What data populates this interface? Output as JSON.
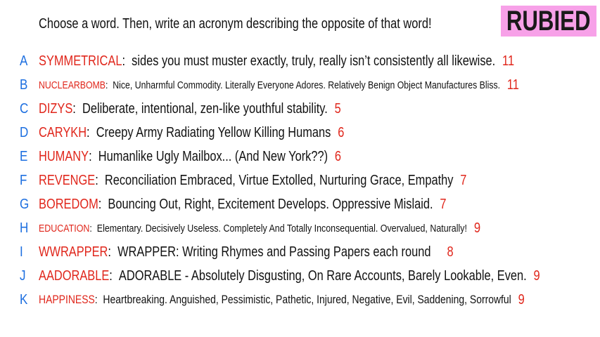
{
  "prompt": "Choose a word. Then, write an acronym describing the opposite of that word!",
  "logo": "RUBIED",
  "rows": [
    {
      "letter": "A",
      "word": "SYMMETRICAL",
      "definition": "sides you must muster exactly, truly, really isn’t consistently all likewise.",
      "score": "11"
    },
    {
      "letter": "B",
      "word": "NUCLEARBOMB",
      "definition": "Nice, Unharmful Commodity. Literally Everyone Adores. Relatively Benign Object Manufactures Bliss.",
      "score": "11"
    },
    {
      "letter": "C",
      "word": "DIZYS",
      "definition": "Deliberate, intentional, zen-like youthful stability.",
      "score": "5"
    },
    {
      "letter": "D",
      "word": "CARYKH",
      "definition": "Creepy Army Radiating Yellow Killing Humans",
      "score": "6"
    },
    {
      "letter": "E",
      "word": "HUMANY",
      "definition": "Humanlike Ugly Mailbox... (And New York??)",
      "score": "6"
    },
    {
      "letter": "F",
      "word": "REVENGE",
      "definition": "Reconciliation Embraced, Virtue Extolled, Nurturing Grace, Empathy",
      "score": "7"
    },
    {
      "letter": "G",
      "word": "BOREDOM",
      "definition": "Bouncing Out, Right, Excitement Develops. Oppressive Mislaid.",
      "score": "7"
    },
    {
      "letter": "H",
      "word": "EDUCATION",
      "definition": "Elementary. Decisively Useless. Completely And Totally Inconsequential. Overvalued, Naturally!",
      "score": "9"
    },
    {
      "letter": "I",
      "word": "WWRAPPER",
      "definition": "WRAPPER: Writing Rhymes and Passing Papers each round",
      "score": "8"
    },
    {
      "letter": "J",
      "word": "AADORABLE",
      "definition": "ADORABLE - Absolutely Disgusting, On Rare Accounts, Barely Lookable, Even.",
      "score": "9"
    },
    {
      "letter": "K",
      "word": "HAPPINESS",
      "definition": "Heartbreaking. Anguished, Pessimistic, Pathetic, Injured, Negative, Evil, Saddening, Sorrowful",
      "score": "9"
    }
  ],
  "colors": {
    "word": "#e0261b",
    "letter": "#1d6fe0",
    "logo_bg": "#f7a1e8"
  }
}
